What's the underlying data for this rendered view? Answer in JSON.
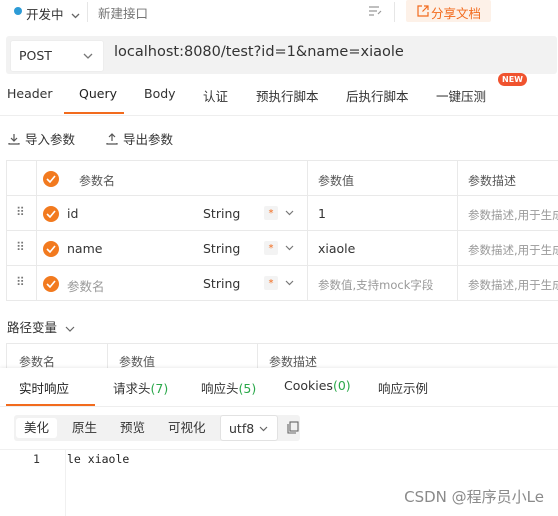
{
  "topbar": {
    "env_label": "开发中",
    "api_name_placeholder": "新建接口",
    "share_label": "分享文档",
    "colors": {
      "status": "#2d9bd6",
      "accent": "#f26b1d"
    }
  },
  "request": {
    "method": "POST",
    "url": "localhost:8080/test?id=1&name=xiaole"
  },
  "tabs": [
    {
      "label": "Header"
    },
    {
      "label": "Query"
    },
    {
      "label": "Body"
    },
    {
      "label": "认证"
    },
    {
      "label": "预执行脚本"
    },
    {
      "label": "后执行脚本"
    },
    {
      "label": "一键压测",
      "badge": "NEW"
    }
  ],
  "actions": {
    "import": "导入参数",
    "export": "导出参数"
  },
  "params_table": {
    "headers": [
      "参数名",
      "参数值",
      "参数描述"
    ],
    "rows": [
      {
        "name": "id",
        "type": "String",
        "required_mark": "*",
        "value": "1",
        "desc_placeholder": "参数描述,用于生成"
      },
      {
        "name": "name",
        "type": "String",
        "required_mark": "*",
        "value": "xiaole",
        "desc_placeholder": "参数描述,用于生成"
      },
      {
        "name_placeholder": "参数名",
        "type": "String",
        "required_mark": "*",
        "value_placeholder": "参数值,支持mock字段",
        "desc_placeholder": "参数描述,用于生成"
      }
    ]
  },
  "path_vars": {
    "title": "路径变量",
    "headers": [
      "参数名",
      "参数值",
      "参数描述"
    ]
  },
  "response": {
    "tabs": [
      {
        "label": "实时响应"
      },
      {
        "label": "请求头",
        "count": "(7)"
      },
      {
        "label": "响应头",
        "count": "(5)"
      },
      {
        "label": "Cookies",
        "count": "(0)"
      },
      {
        "label": "响应示例"
      }
    ],
    "view_tabs": [
      "美化",
      "原生",
      "预览",
      "可视化"
    ],
    "encoding": "utf8",
    "body_lines": [
      {
        "line_no": "1",
        "text": "le xiaole"
      }
    ]
  },
  "watermark": "CSDN @程序员小Le"
}
